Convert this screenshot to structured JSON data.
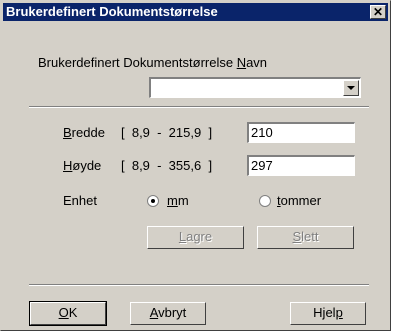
{
  "window": {
    "title": "Brukerdefinert Dokumentstørrelse",
    "close_glyph": "✕"
  },
  "name_section": {
    "label_pre": "Brukerdefinert Dokumentstørrelse ",
    "label_mnemonic": "N",
    "label_post": "avn",
    "value": ""
  },
  "width": {
    "label_mnemonic": "B",
    "label_rest": "redde",
    "range": "[  8,9  -  215,9  ]",
    "value": "210"
  },
  "height": {
    "label_mnemonic": "H",
    "label_rest": "øyde",
    "range": "[  8,9  -  355,6  ]",
    "value": "297"
  },
  "unit": {
    "label": "Enhet",
    "options": [
      {
        "mnemonic": "m",
        "rest": "m",
        "selected": true
      },
      {
        "mnemonic": "t",
        "rest": "ommer",
        "selected": false
      }
    ]
  },
  "actions": {
    "save": {
      "mnemonic": "L",
      "rest": "agre",
      "enabled": false
    },
    "delete": {
      "mnemonic": "S",
      "rest": "lett",
      "enabled": false
    }
  },
  "footer": {
    "ok": {
      "mnemonic": "O",
      "rest": "K"
    },
    "cancel": {
      "mnemonic": "A",
      "rest": "vbryt"
    },
    "help": {
      "pre": "Hjel",
      "mnemonic": "p"
    }
  }
}
